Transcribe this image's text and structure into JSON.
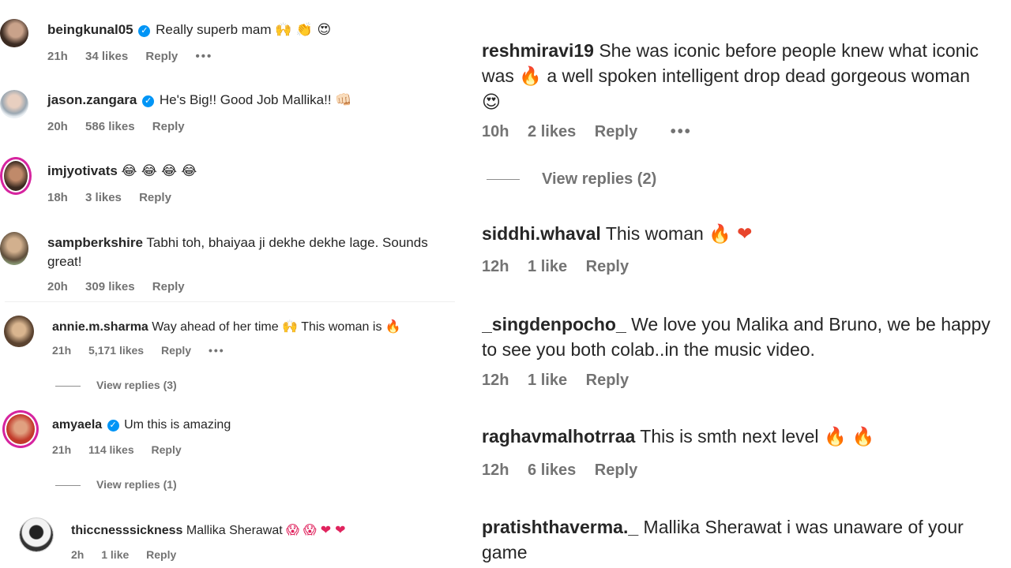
{
  "left_comments": [
    {
      "user": "beingkunal05",
      "verified": true,
      "text": "Really superb mam",
      "emoji": "🙌 👏 😍",
      "time": "21h",
      "likes": "34 likes",
      "reply": "Reply",
      "more": "•••"
    },
    {
      "user": "jason.zangara",
      "verified": true,
      "text": "He's Big!! Good Job Mallika!!",
      "emoji": "👊🏻",
      "time": "20h",
      "likes": "586 likes",
      "reply": "Reply"
    },
    {
      "user": "imjyotivats",
      "verified": false,
      "text": "",
      "emoji": "😂 😂 😂 😂",
      "time": "18h",
      "likes": "3 likes",
      "reply": "Reply"
    },
    {
      "user": "sampberkshire",
      "verified": false,
      "text": "Tabhi toh, bhaiyaa ji dekhe dekhe lage. Sounds",
      "text2": "great!",
      "time": "20h",
      "likes": "309 likes",
      "reply": "Reply"
    },
    {
      "user": "annie.m.sharma",
      "verified": false,
      "text": "Way ahead of her time",
      "emoji": "🙌",
      "text_b": "This woman is",
      "emoji_b": "🔥",
      "time": "21h",
      "likes": "5,171 likes",
      "reply": "Reply",
      "more": "•••",
      "view_replies": "View replies (3)"
    },
    {
      "user": "amyaela",
      "verified": true,
      "text": "Um this is amazing",
      "time": "21h",
      "likes": "114 likes",
      "reply": "Reply",
      "view_replies": "View replies (1)"
    },
    {
      "user": "thiccnesssickness",
      "verified": false,
      "text": "Mallika Sherawat",
      "emoji": "😱 😱 ❤ ❤",
      "time": "2h",
      "likes": "1 like",
      "reply": "Reply"
    }
  ],
  "right_comments": [
    {
      "user": "reshmiravi19",
      "text": "She was iconic before people knew what iconic",
      "text2": "was",
      "emoji2": "🔥",
      "text2b": "a well spoken intelligent drop dead gorgeous woman",
      "emoji3": "😍",
      "time": "10h",
      "likes": "2 likes",
      "reply": "Reply",
      "more": "•••",
      "view_replies": "View replies (2)"
    },
    {
      "user": "siddhi.whaval",
      "text": "This woman",
      "emoji": "🔥 ❤",
      "time": "12h",
      "likes": "1 like",
      "reply": "Reply"
    },
    {
      "user": "_singdenpocho_",
      "text": "We love you Malika and Bruno, we be happy",
      "text2": "to see you both colab..in the music video.",
      "time": "12h",
      "likes": "1 like",
      "reply": "Reply"
    },
    {
      "user": "raghavmalhotrraa",
      "text": "This is smth next level",
      "emoji": "🔥 🔥",
      "time": "12h",
      "likes": "6 likes",
      "reply": "Reply"
    },
    {
      "user": "pratishthaverma._",
      "text": "Mallika Sherawat i was unaware of your",
      "text2": "game"
    }
  ],
  "colors": {
    "accent": "#0095f6",
    "story_ring": "#d6249f",
    "meta": "#737373"
  }
}
